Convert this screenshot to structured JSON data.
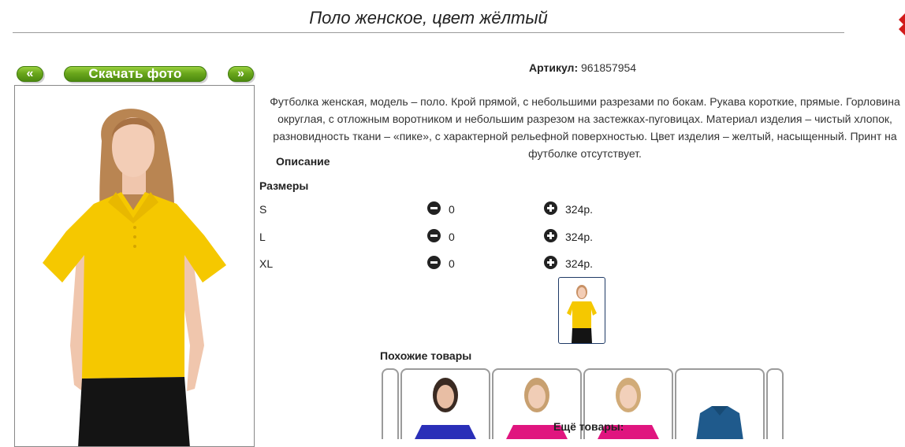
{
  "product": {
    "title": "Поло женское, цвет жёлтый",
    "article_label": "Артикул:",
    "article_value": "961857954",
    "description": "Футболка женская, модель – поло. Крой прямой, с небольшими разрезами по бокам. Рукава короткие, прямые. Горловина округлая, с отложным воротником и небольшим разрезом на застежках-пуговицах. Материал изделия – чистый хлопок, разновидность ткани – «пике», с характерной рельефной поверхностью. Цвет изделия – желтый, насыщенный. Принт на футболке отсутствует."
  },
  "gallery": {
    "prev_label": "«",
    "download_label": "Скачать фото",
    "next_label": "»"
  },
  "sections": {
    "description_heading": "Описание",
    "sizes_heading": "Размеры",
    "similar_heading": "Похожие товары",
    "more_heading": "Ещё товары:"
  },
  "sizes": [
    {
      "name": "S",
      "qty": "0",
      "price": "324р."
    },
    {
      "name": "L",
      "qty": "0",
      "price": "324р."
    },
    {
      "name": "XL",
      "qty": "0",
      "price": "324р."
    }
  ],
  "colors": {
    "shirt_yellow": "#f5c800",
    "accent_green": "#6aa71c",
    "similar_blue": "#2a2fb8",
    "similar_pink": "#e0157f",
    "similar_denim": "#1f5a8c"
  }
}
